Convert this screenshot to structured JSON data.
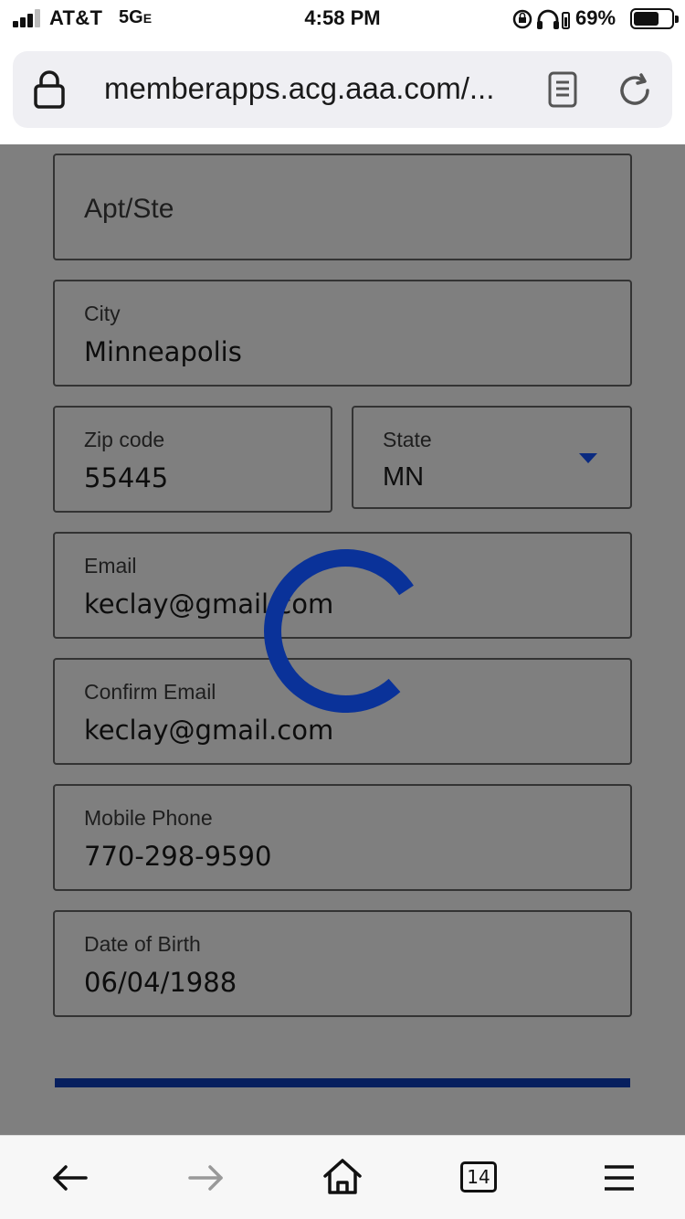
{
  "status_bar": {
    "carrier": "AT&T",
    "network": "5G",
    "network_suffix": "E",
    "time": "4:58 PM",
    "battery_percent": "69%",
    "battery_level": 0.69,
    "signal_bars": 3
  },
  "browser": {
    "url": "memberapps.acg.aaa.com/...",
    "tab_count": "14"
  },
  "form": {
    "apt": {
      "placeholder": "Apt/Ste"
    },
    "city": {
      "label": "City",
      "value": "Minneapolis"
    },
    "zip": {
      "label": "Zip code",
      "value": "55445"
    },
    "state": {
      "label": "State",
      "value": "MN"
    },
    "email": {
      "label": "Email",
      "value": "keclay@gmail.com"
    },
    "confirm_email": {
      "label": "Confirm Email",
      "value": "keclay@gmail.com"
    },
    "mobile_phone": {
      "label": "Mobile Phone",
      "value": "770-298-9590"
    },
    "dob": {
      "label": "Date of Birth",
      "value": "06/04/1988"
    }
  },
  "colors": {
    "overlay": "#7f7f7f",
    "spinner": "#0a3299",
    "submit_bar": "#071f5e",
    "accent_arrow": "#0a2a80"
  },
  "icons": {
    "lock": "lock-icon",
    "reader": "reader-icon",
    "reload": "reload-icon",
    "back": "back-arrow-icon",
    "forward": "forward-arrow-icon",
    "home": "home-icon",
    "tabs": "tabs-icon",
    "menu": "menu-icon",
    "spinner": "loading-spinner-icon"
  }
}
